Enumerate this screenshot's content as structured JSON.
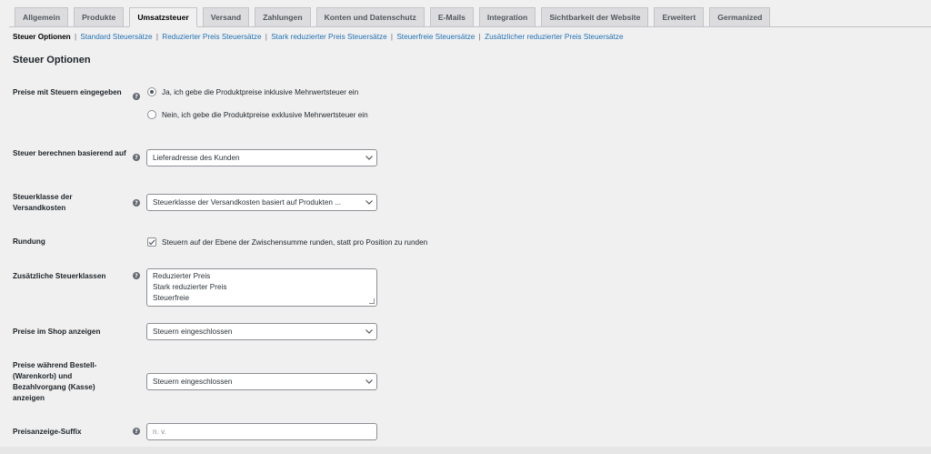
{
  "tabs": [
    {
      "label": "Allgemein",
      "active": false
    },
    {
      "label": "Produkte",
      "active": false
    },
    {
      "label": "Umsatzsteuer",
      "active": true
    },
    {
      "label": "Versand",
      "active": false
    },
    {
      "label": "Zahlungen",
      "active": false
    },
    {
      "label": "Konten und Datenschutz",
      "active": false
    },
    {
      "label": "E-Mails",
      "active": false
    },
    {
      "label": "Integration",
      "active": false
    },
    {
      "label": "Sichtbarkeit der Website",
      "active": false
    },
    {
      "label": "Erweitert",
      "active": false
    },
    {
      "label": "Germanized",
      "active": false
    }
  ],
  "subnav": {
    "current": "Steuer Optionen",
    "links": [
      "Standard Steuersätze",
      "Reduzierter Preis Steuersätze",
      "Stark reduzierter Preis Steuersätze",
      "Steuerfreie Steuersätze",
      "Zusätzlicher reduzierter Preis Steuersätze"
    ],
    "separator": "|"
  },
  "section_title": "Steuer Optionen",
  "help_glyph": "?",
  "fields": {
    "prices_entered": {
      "label": "Preise mit Steuern eingegeben",
      "options": [
        {
          "label": "Ja, ich gebe die Produktpreise inklusive Mehrwertsteuer ein",
          "selected": true
        },
        {
          "label": "Nein, ich gebe die Produktpreise exklusive Mehrwertsteuer ein",
          "selected": false
        }
      ]
    },
    "tax_based_on": {
      "label": "Steuer berechnen basierend auf",
      "value": "Lieferadresse des Kunden"
    },
    "shipping_tax_class": {
      "label": "Steuerklasse der Versandkosten",
      "value": "Steuerklasse der Versandkosten basiert auf Produkten ..."
    },
    "rounding": {
      "label": "Rundung",
      "checkbox_label": "Steuern auf der Ebene der Zwischensumme runden, statt pro Position zu runden",
      "checked": true
    },
    "additional_classes": {
      "label": "Zusätzliche Steuerklassen",
      "lines": [
        "Reduzierter Preis",
        "Stark reduzierter Preis",
        "Steuerfreie"
      ]
    },
    "shop_display": {
      "label": "Preise im Shop anzeigen",
      "value": "Steuern eingeschlossen"
    },
    "cart_display": {
      "label": "Preise während Bestell- (Warenkorb) und Bezahlvorgang (Kasse) anzeigen",
      "value": "Steuern eingeschlossen"
    },
    "price_suffix": {
      "label": "Preisanzeige-Suffix",
      "placeholder": "n. v."
    }
  }
}
